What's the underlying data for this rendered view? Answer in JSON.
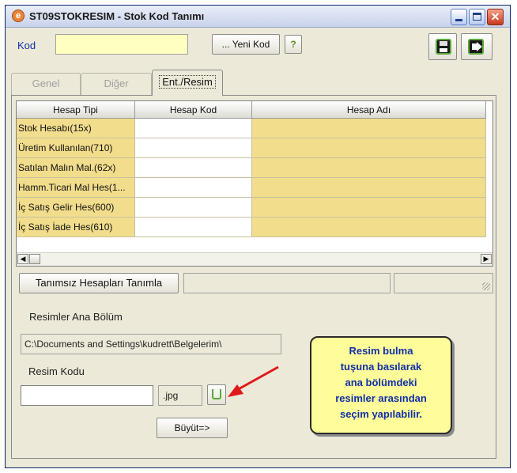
{
  "window": {
    "title": "ST09STOKRESIM - Stok Kod Tanımı",
    "close_glyph": "✕"
  },
  "toolbar": {
    "kod_label": "Kod",
    "kod_value": "",
    "yeni_kod_label": "... Yeni Kod",
    "help_label": "?"
  },
  "tabs": [
    {
      "label": "Genel",
      "active": false
    },
    {
      "label": "Diğer",
      "active": false
    },
    {
      "label": "Ent./Resim",
      "active": true
    }
  ],
  "grid": {
    "columns": [
      "Hesap Tipi",
      "Hesap Kod",
      "Hesap Adı"
    ],
    "rows": [
      {
        "hesap_tipi": "Stok Hesabı(15x)",
        "hesap_kod": "",
        "hesap_adi": ""
      },
      {
        "hesap_tipi": "Üretim Kullanılan(710)",
        "hesap_kod": "",
        "hesap_adi": ""
      },
      {
        "hesap_tipi": "Satılan Malın Mal.(62x)",
        "hesap_kod": "",
        "hesap_adi": ""
      },
      {
        "hesap_tipi": "Hamm.Ticari Mal Hes(1...",
        "hesap_kod": "",
        "hesap_adi": ""
      },
      {
        "hesap_tipi": "İç Satış Gelir Hes(600)",
        "hesap_kod": "",
        "hesap_adi": ""
      },
      {
        "hesap_tipi": "İç Satış İade Hes(610)",
        "hesap_kod": "",
        "hesap_adi": ""
      }
    ],
    "scroll_left": "◀",
    "scroll_right": "▶"
  },
  "actions": {
    "tanimsiz_label": "Tanımsız Hesapları Tanımla",
    "buyut_label": "Büyüt=>"
  },
  "resim": {
    "ana_bolum_label": "Resimler Ana Bölüm",
    "path_value": "C:\\Documents and Settings\\kudrett\\Belgelerim\\",
    "kodu_label": "Resim Kodu",
    "kodu_value": "",
    "extension": ".jpg"
  },
  "callout": {
    "lines": [
      "Resim bulma",
      "tuşuna basılarak",
      "ana bölümdeki",
      "resimler arasından",
      "seçim yapılabilir."
    ]
  },
  "colors": {
    "grid_highlight": "#f2dd8c",
    "input_yellow": "#ffffc0",
    "callout_bg": "#fffc9a",
    "callout_text": "#1030a8",
    "arrow": "#e01818"
  }
}
